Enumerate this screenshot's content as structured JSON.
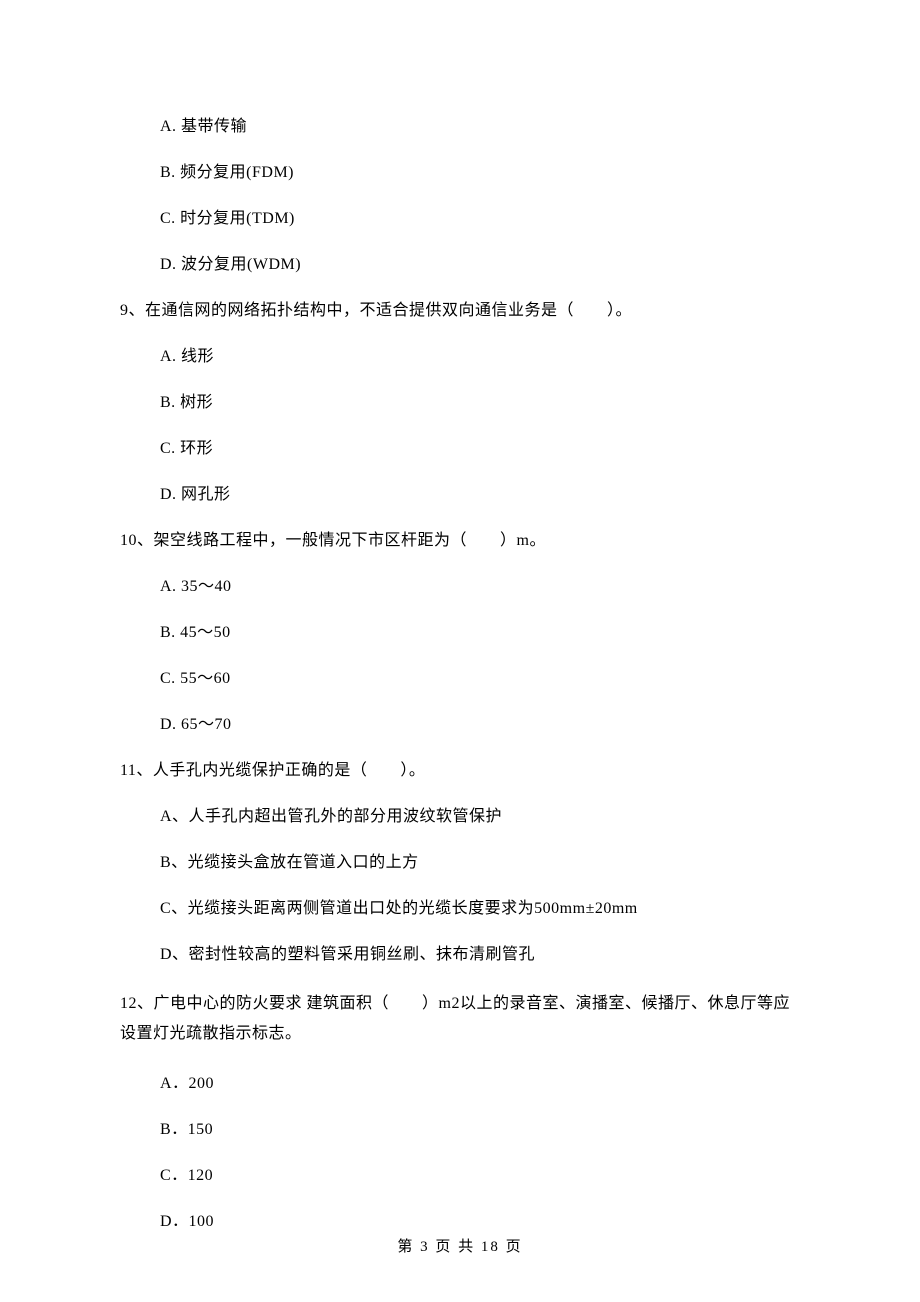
{
  "q_prev_options": {
    "a": "A. 基带传输",
    "b": "B. 频分复用(FDM)",
    "c": "C. 时分复用(TDM)",
    "d": "D. 波分复用(WDM)"
  },
  "q9": {
    "stem": "9、在通信网的网络拓扑结构中，不适合提供双向通信业务是（　　）。",
    "a": "A. 线形",
    "b": "B. 树形",
    "c": "C. 环形",
    "d": "D. 网孔形"
  },
  "q10": {
    "stem": "10、架空线路工程中，一般情况下市区杆距为（　　）m。",
    "a": "A. 35～40",
    "b": "B. 45～50",
    "c": "C. 55～60",
    "d": "D. 65～70"
  },
  "q11": {
    "stem": "11、人手孔内光缆保护正确的是（　　）。",
    "a": "A、人手孔内超出管孔外的部分用波纹软管保护",
    "b": "B、光缆接头盒放在管道入口的上方",
    "c": "C、光缆接头距离两侧管道出口处的光缆长度要求为500mm±20mm",
    "d": "D、密封性较高的塑料管采用铜丝刷、抹布清刷管孔"
  },
  "q12": {
    "stem": "12、广电中心的防火要求 建筑面积（　　）m2以上的录音室、演播室、候播厅、休息厅等应设置灯光疏散指示标志。",
    "a": "A．200",
    "b": "B．150",
    "c": "C．120",
    "d": "D．100"
  },
  "footer": "第 3 页 共 18 页"
}
